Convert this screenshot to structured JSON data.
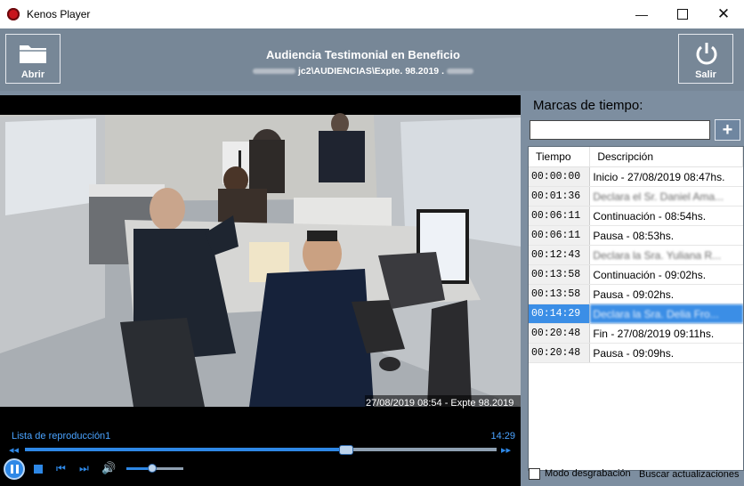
{
  "window": {
    "title": "Kenos Player",
    "controls": [
      "minimize-icon",
      "maximize-icon",
      "close-icon"
    ]
  },
  "header": {
    "open_label": "Abrir",
    "exit_label": "Salir",
    "title": "Audiencia Testimonial en Beneficio",
    "path": "jc2\\AUDIENCIAS\\Expte. 98.2019 ."
  },
  "video": {
    "overlay": "27/08/2019 08:54 - Expte 98.2019"
  },
  "player": {
    "playlist_label": "Lista de reproducción1",
    "time": "14:29",
    "progress": 0.68,
    "volume": 0.45
  },
  "marks": {
    "heading": "Marcas de tiempo:",
    "input_value": "",
    "add_icon": "plus-icon",
    "columns": [
      "Tiempo",
      "Descripción"
    ],
    "rows": [
      {
        "time": "00:00:00",
        "desc": "Inicio - 27/08/2019 08:47hs.",
        "redacted": false
      },
      {
        "time": "00:01:36",
        "desc": "Declara el Sr. Daniel Ama...",
        "redacted": true
      },
      {
        "time": "00:06:11",
        "desc": "Continuación - 08:54hs.",
        "redacted": false
      },
      {
        "time": "00:06:11",
        "desc": "Pausa - 08:53hs.",
        "redacted": false
      },
      {
        "time": "00:12:43",
        "desc": "Declara la Sra. Yuliana R...",
        "redacted": true
      },
      {
        "time": "00:13:58",
        "desc": "Continuación - 09:02hs.",
        "redacted": false
      },
      {
        "time": "00:13:58",
        "desc": "Pausa - 09:02hs.",
        "redacted": false
      },
      {
        "time": "00:14:29",
        "desc": "Declara la Sra. Delia Fro...",
        "redacted": true,
        "selected": true
      },
      {
        "time": "00:20:48",
        "desc": "Fin - 27/08/2019 09:11hs.",
        "redacted": false
      },
      {
        "time": "00:20:48",
        "desc": "Pausa - 09:09hs.",
        "redacted": false
      }
    ]
  },
  "footer": {
    "checkbox_label": "Modo desgrabación",
    "update_link": "Buscar actualizaciones"
  }
}
